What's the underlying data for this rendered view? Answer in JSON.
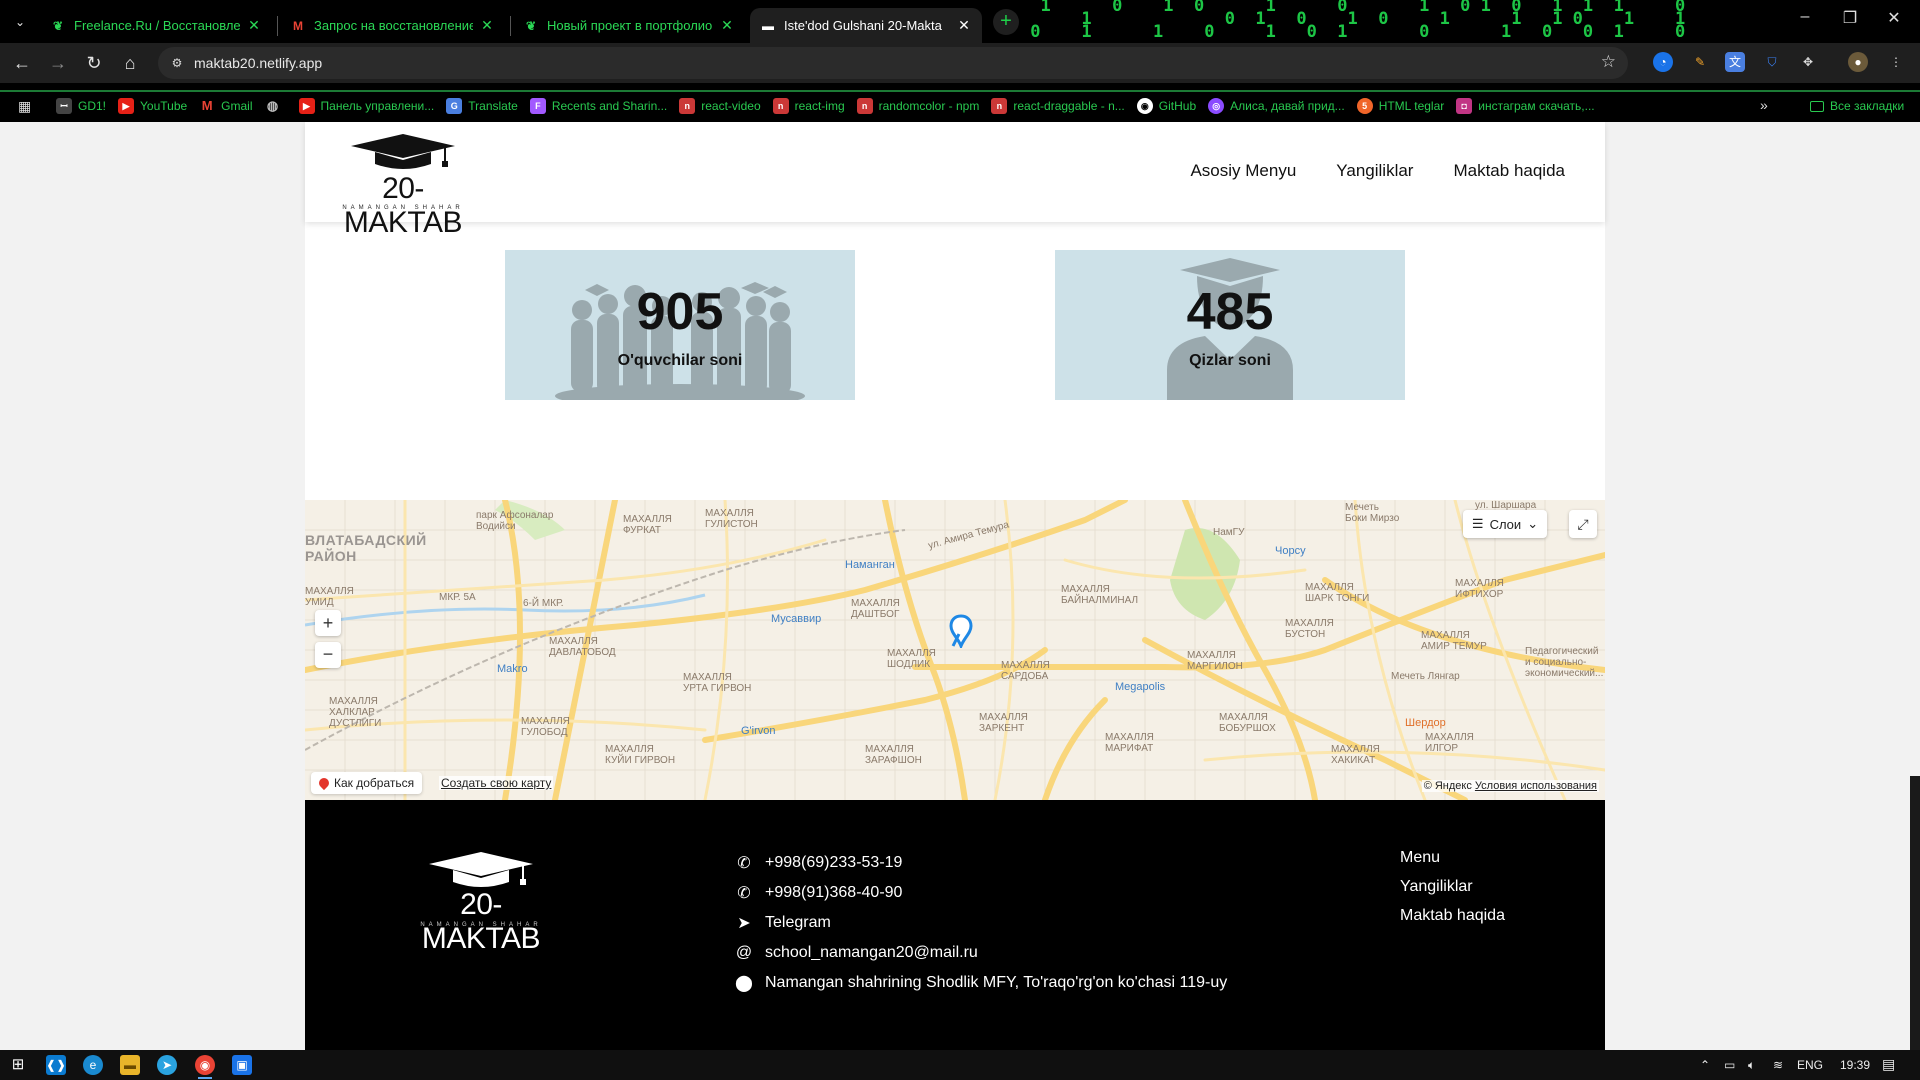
{
  "browser": {
    "tabs": [
      {
        "title": "Freelance.Ru / Восстановление",
        "active": false,
        "icon": "freelance-icon"
      },
      {
        "title": "Запрос на восстановление за",
        "active": false,
        "icon": "gmail-icon"
      },
      {
        "title": "Новый проект в портфолио",
        "active": false,
        "icon": "freelance-icon"
      },
      {
        "title": "Iste'dod Gulshani 20-Makta",
        "active": true,
        "icon": "site-icon"
      }
    ],
    "url": "maktab20.netlify.app",
    "bookmarks": [
      {
        "label": "GD1!",
        "color": "#444444"
      },
      {
        "label": "YouTube",
        "color": "#e62117"
      },
      {
        "label": "Gmail",
        "color": "#d93025"
      },
      {
        "label": "",
        "color": "#555555"
      },
      {
        "label": "Панель управлени...",
        "color": "#e62117"
      },
      {
        "label": "Translate",
        "color": "#4a7fe0"
      },
      {
        "label": "Recents and Sharin...",
        "color": "#a259ff"
      },
      {
        "label": "react-video",
        "color": "#cb3837"
      },
      {
        "label": "react-img",
        "color": "#cb3837"
      },
      {
        "label": "randomcolor - npm",
        "color": "#cb3837"
      },
      {
        "label": "react-draggable - n...",
        "color": "#cb3837"
      },
      {
        "label": "GitHub",
        "color": "#333333"
      },
      {
        "label": "Алиса, давай прид...",
        "color": "#8a4bff"
      },
      {
        "label": "HTML teglar",
        "color": "#f06529"
      },
      {
        "label": "инстаграм скачать,...",
        "color": "#c13584"
      }
    ],
    "all_bookmarks": "Все закладки"
  },
  "site": {
    "logo": {
      "word": "20-MAKTAB",
      "sub": "NAMANGAN SHAHAR"
    },
    "nav": [
      "Asosiy Menyu",
      "Yangiliklar",
      "Maktab haqida"
    ],
    "stats": [
      {
        "value": "905",
        "label": "O'quvchilar soni"
      },
      {
        "value": "485",
        "label": "Qizlar soni"
      }
    ],
    "map": {
      "layers_label": "Слои",
      "route_label": "Как добраться",
      "create_label": "Создать свою карту",
      "copyright": "© Яндекс",
      "terms": "Условия использования",
      "labels": [
        {
          "text": "ВЛАТАБАДСКИЙ\nРАЙОН",
          "kind": "big"
        },
        {
          "text": "парк Афсоналар\nВодийси",
          "kind": "plain"
        },
        {
          "text": "МАХАЛЛЯ\nГУЛИСТОН",
          "kind": "plain"
        },
        {
          "text": "МАХАЛЛЯ\nФУРКАТ",
          "kind": "plain"
        },
        {
          "text": "ул. Амира Темура",
          "kind": "plain"
        },
        {
          "text": "Наманган",
          "kind": "poi"
        },
        {
          "text": "НамГУ",
          "kind": "grey"
        },
        {
          "text": "Чорсу",
          "kind": "poi"
        },
        {
          "text": "Мечеть\nБоки Мирзо",
          "kind": "grey"
        },
        {
          "text": "ул. Шаршара",
          "kind": "plain"
        },
        {
          "text": "МАХАЛЛЯ\nУМИД",
          "kind": "plain"
        },
        {
          "text": "МКР. 5А",
          "kind": "plain"
        },
        {
          "text": "6-Й МКР.",
          "kind": "plain"
        },
        {
          "text": "Мусаввир",
          "kind": "poi"
        },
        {
          "text": "МАХАЛЛЯ\nДАШТБОГ",
          "kind": "plain"
        },
        {
          "text": "МАХАЛЛЯ\nБАЙНАЛМИНАЛ",
          "kind": "plain"
        },
        {
          "text": "МАХАЛЛЯ\nШАРК ТОНГИ",
          "kind": "plain"
        },
        {
          "text": "МАХАЛЛЯ\nИФТИХОР",
          "kind": "plain"
        },
        {
          "text": "Makro",
          "kind": "poi"
        },
        {
          "text": "МАХАЛЛЯ\nДАВЛАТОБОД",
          "kind": "plain"
        },
        {
          "text": "МАХАЛЛЯ\nШОДЛИК",
          "kind": "plain"
        },
        {
          "text": "МАХАЛЛЯ\nСАРДОБА",
          "kind": "plain"
        },
        {
          "text": "Megapolis",
          "kind": "poi"
        },
        {
          "text": "МАХАЛЛЯ\nМАРГИЛОН",
          "kind": "plain"
        },
        {
          "text": "МАХАЛЛЯ\nБУСТОН",
          "kind": "plain"
        },
        {
          "text": "Мечеть Лянгар",
          "kind": "grey"
        },
        {
          "text": "МАХАЛЛЯ\nАМИР ТЕМУР",
          "kind": "plain"
        },
        {
          "text": "Педагогический\nи социально-\nэкономический...",
          "kind": "grey"
        },
        {
          "text": "МАХАЛЛЯ\nХАЛКЛАР\nДУСТЛИГИ",
          "kind": "plain"
        },
        {
          "text": "МАХАЛЛЯ\nУРТА ГИРВОН",
          "kind": "plain"
        },
        {
          "text": "МАХАЛЛЯ\nГУЛОБОД",
          "kind": "plain"
        },
        {
          "text": "G'irvon",
          "kind": "poi"
        },
        {
          "text": "МАХАЛЛЯ\nЗАРКЕНТ",
          "kind": "plain"
        },
        {
          "text": "МАХАЛЛЯ\nМАРИФАТ",
          "kind": "plain"
        },
        {
          "text": "МАХАЛЛЯ\nБОБУРШОХ",
          "kind": "plain"
        },
        {
          "text": "Шердор",
          "kind": "orange"
        },
        {
          "text": "МАХАЛЛЯ\nКУЙИ ГИРВОН",
          "kind": "plain"
        },
        {
          "text": "МАХАЛЛЯ\nЗАРАФШОН",
          "kind": "plain"
        },
        {
          "text": "МАХАЛЛЯ\nХАКИКАТ",
          "kind": "plain"
        },
        {
          "text": "МАХАЛЛЯ\nИЛГОР",
          "kind": "plain"
        }
      ]
    },
    "footer": {
      "contacts": [
        {
          "icon": "phone-icon",
          "text": "+998(69)233-53-19"
        },
        {
          "icon": "phone-icon",
          "text": "+998(91)368-40-90"
        },
        {
          "icon": "telegram-icon",
          "text": "Telegram"
        },
        {
          "icon": "at-icon",
          "text": "school_namangan20@mail.ru"
        },
        {
          "icon": "location-pin-icon",
          "text": "Namangan shahrining Shodlik MFY, To'raqo'rg'on ko'chasi 119-uy"
        }
      ],
      "menu": [
        "Menu",
        "Yangiliklar",
        "Maktab haqida"
      ]
    }
  },
  "taskbar": {
    "lang": "ENG",
    "time": "19:39"
  }
}
